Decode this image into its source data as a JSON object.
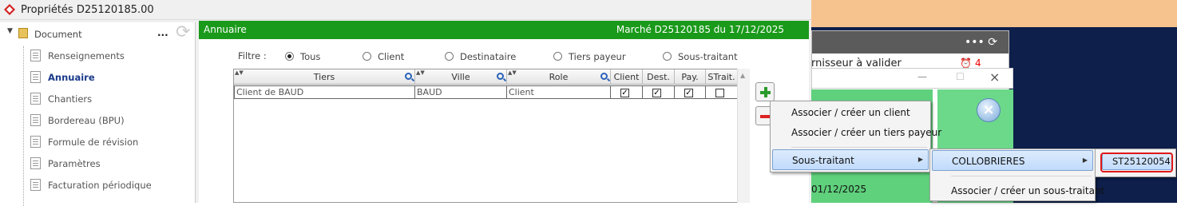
{
  "window": {
    "title": "Propriétés D25120185.00"
  },
  "tree": {
    "root": "Document",
    "more": "...",
    "items": [
      {
        "label": "Renseignements"
      },
      {
        "label": "Annuaire"
      },
      {
        "label": "Chantiers"
      },
      {
        "label": "Bordereau (BPU)"
      },
      {
        "label": "Formule de révision"
      },
      {
        "label": "Paramètres"
      },
      {
        "label": "Facturation périodique"
      }
    ]
  },
  "panel": {
    "title": "Annuaire",
    "subtitle": "Marché D25120185 du 17/12/2025",
    "filter_label": "Filtre :",
    "filters": [
      "Tous",
      "Client",
      "Destinataire",
      "Tiers payeur",
      "Sous-traitant"
    ],
    "selected_filter": "Tous"
  },
  "table": {
    "columns": [
      "Tiers",
      "Ville",
      "Role",
      "Client",
      "Dest.",
      "Pay.",
      "STrait."
    ],
    "rows": [
      {
        "tiers": "Client de BAUD",
        "ville": "BAUD",
        "role": "Client",
        "client": true,
        "dest": true,
        "pay": true,
        "strait": false
      }
    ]
  },
  "context_menu": {
    "items": [
      "Associer / créer un client",
      "Associer / créer un tiers payeur",
      "Sous-traitant"
    ]
  },
  "submenu": {
    "items": [
      "COLLOBRIERES",
      "Associer / créer un sous-traitant"
    ]
  },
  "submenu2": {
    "items": [
      "ST25120054"
    ]
  },
  "background": {
    "alert_text": "rnisseur à valider",
    "alert_count": "4",
    "date": "01/12/2025",
    "menu_dots": "•••"
  },
  "colors": {
    "header_green": "#1a9a1a",
    "highlight_border": "#e01818",
    "menu_hover": "#c1dbfc"
  }
}
